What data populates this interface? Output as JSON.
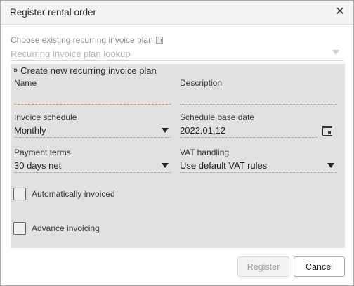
{
  "dialog": {
    "title": "Register rental order",
    "close_icon": "close-icon"
  },
  "existing_plan": {
    "label": "Choose existing recurring invoice plan",
    "placeholder": "Recurring invoice plan lookup"
  },
  "new_plan": {
    "header": "Create new recurring invoice plan",
    "name_label": "Name",
    "name_value": "",
    "description_label": "Description",
    "description_value": "",
    "invoice_schedule_label": "Invoice schedule",
    "invoice_schedule_value": "Monthly",
    "schedule_base_date_label": "Schedule base date",
    "schedule_base_date_value": "2022.01.12",
    "payment_terms_label": "Payment terms",
    "payment_terms_value": "30 days net",
    "vat_handling_label": "VAT handling",
    "vat_handling_value": "Use default VAT rules",
    "auto_invoiced_label": "Automatically invoiced",
    "auto_invoiced_checked": false,
    "advance_invoicing_label": "Advance invoicing",
    "advance_invoicing_checked": false
  },
  "buttons": {
    "register": "Register",
    "cancel": "Cancel"
  },
  "colors": {
    "panel_bg": "#e1e1e1",
    "required_underline": "#e08a3a"
  }
}
